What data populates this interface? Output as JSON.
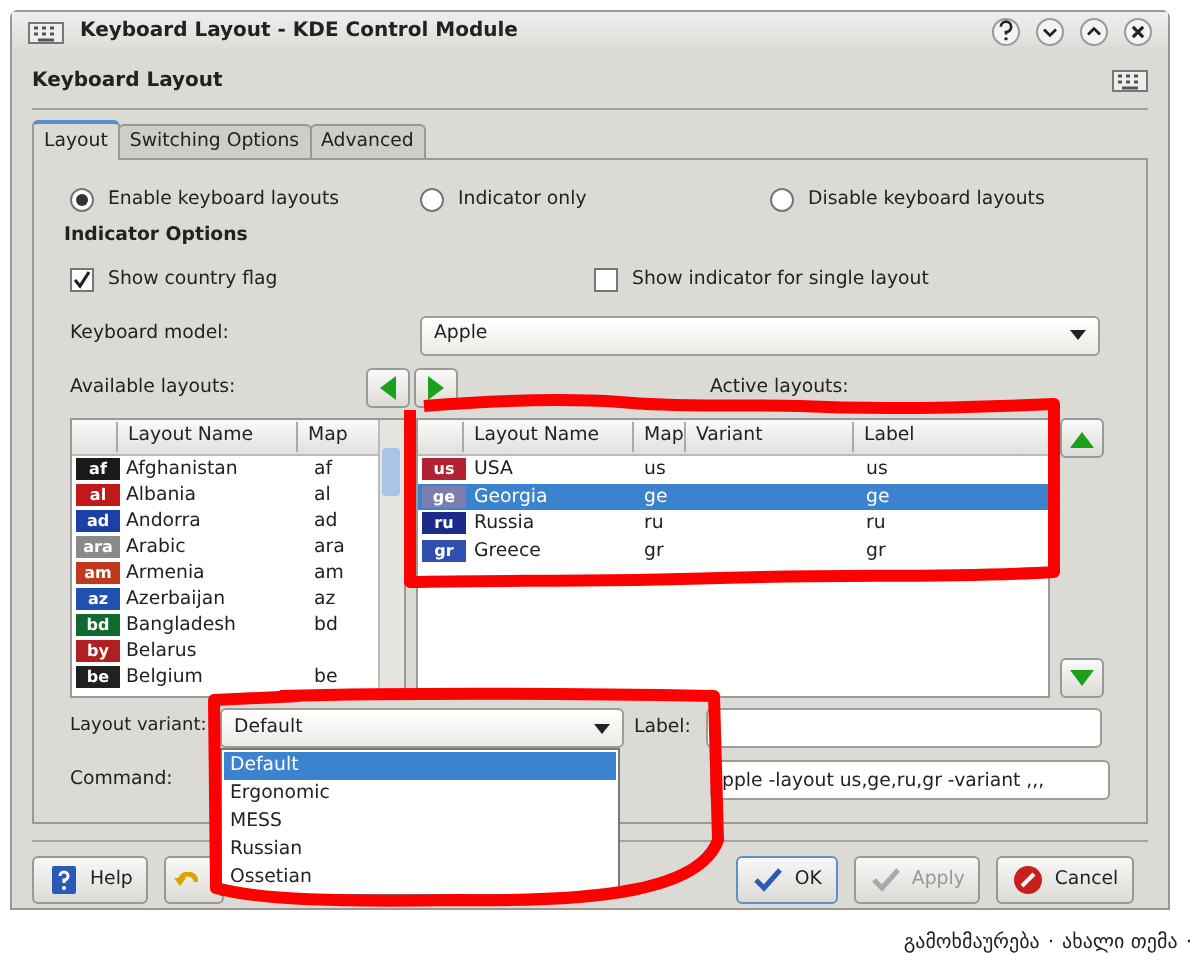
{
  "window": {
    "title": "Keyboard Layout - KDE Control Module"
  },
  "header": {
    "title": "Keyboard Layout"
  },
  "tabs": [
    {
      "label": "Layout",
      "selected": true
    },
    {
      "label": "Switching Options",
      "selected": false
    },
    {
      "label": "Advanced",
      "selected": false
    }
  ],
  "modes": [
    {
      "label": "Enable keyboard layouts",
      "selected": true
    },
    {
      "label": "Indicator only",
      "selected": false
    },
    {
      "label": "Disable keyboard layouts",
      "selected": false
    }
  ],
  "indicator_options": {
    "title": "Indicator Options",
    "options": [
      {
        "label": "Show country flag",
        "checked": true
      },
      {
        "label": "Show indicator for single layout",
        "checked": false
      }
    ]
  },
  "keyboard_model": {
    "label": "Keyboard model:",
    "value": "Apple"
  },
  "available_layouts": {
    "label": "Available layouts:",
    "columns": [
      "Layout Name",
      "Map"
    ],
    "rows": [
      {
        "flag_text": "af",
        "color": "#1a1a1a",
        "name": "Afghanistan",
        "map": "af"
      },
      {
        "flag_text": "al",
        "color": "#c0191c",
        "name": "Albania",
        "map": "al"
      },
      {
        "flag_text": "ad",
        "color": "#1c3fa8",
        "name": "Andorra",
        "map": "ad"
      },
      {
        "flag_text": "ara",
        "color": "#8a8a8a",
        "name": "Arabic",
        "map": "ara"
      },
      {
        "flag_text": "am",
        "color": "#c0391c",
        "name": "Armenia",
        "map": "am"
      },
      {
        "flag_text": "az",
        "color": "#2050b0",
        "name": "Azerbaijan",
        "map": "az"
      },
      {
        "flag_text": "bd",
        "color": "#106a30",
        "name": "Bangladesh",
        "map": "bd"
      },
      {
        "flag_text": "by",
        "color": "#b02020",
        "name": "Belarus"
      },
      {
        "flag_text": "be",
        "color": "#202020",
        "name": "Belgium",
        "map": "be"
      }
    ]
  },
  "active_layouts": {
    "label": "Active layouts:",
    "columns": [
      "Layout Name",
      "Map",
      "Variant",
      "Label"
    ],
    "rows": [
      {
        "flag_text": "us",
        "color": "#b22234",
        "name": "USA",
        "map": "us",
        "label": "us",
        "selected": false
      },
      {
        "flag_text": "ge",
        "color": "#7a7fb0",
        "name": "Georgia",
        "map": "ge",
        "label": "ge",
        "selected": true
      },
      {
        "flag_text": "ru",
        "color": "#1c2a8a",
        "name": "Russia",
        "map": "ru",
        "label": "ru",
        "selected": false
      },
      {
        "flag_text": "gr",
        "color": "#3050b0",
        "name": "Greece",
        "map": "gr",
        "label": "gr",
        "selected": false
      }
    ]
  },
  "layout_variant": {
    "label": "Layout variant:",
    "value": "Default",
    "expanded": true,
    "options": [
      {
        "label": "Default",
        "selected": true
      },
      {
        "label": "Ergonomic",
        "selected": false
      },
      {
        "label": "MESS",
        "selected": false
      },
      {
        "label": "Russian",
        "selected": false
      },
      {
        "label": "Ossetian",
        "selected": false
      }
    ]
  },
  "label_field": {
    "label": "Label:"
  },
  "command": {
    "label": "Command:",
    "value": "pple -layout us,ge,ru,gr -variant ,,,"
  },
  "buttons": [
    {
      "kind": "help",
      "label": "Help",
      "disabled": false
    },
    {
      "kind": "reset",
      "disabled": false
    },
    {
      "kind": "ok",
      "label": "OK",
      "disabled": false
    },
    {
      "kind": "apply",
      "label": "Apply",
      "disabled": true
    },
    {
      "kind": "cancel",
      "label": "Cancel",
      "disabled": false
    }
  ],
  "footer": {
    "links": [
      "გამოხმაურება",
      "ახალი თემა"
    ],
    "separator": "·"
  }
}
